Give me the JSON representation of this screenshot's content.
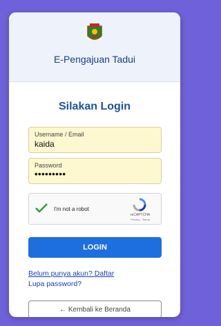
{
  "header": {
    "app_title": "E-Pengajuan Tadui",
    "logo_icon": "regency-crest-icon"
  },
  "login": {
    "title": "Silakan Login",
    "username": {
      "label": "Username / Email",
      "value": "kaida"
    },
    "password": {
      "label": "Password",
      "value": "•••••••••"
    },
    "captcha": {
      "label": "I'm not a robot",
      "brand": "reCAPTCHA",
      "links": "Privacy - Terms"
    },
    "submit_label": "LOGIN",
    "register_link": "Belum punya akun? Daftar",
    "forgot_link": "Lupa password?",
    "back_label": "← Kembali ke Beranda"
  },
  "colors": {
    "background": "#6f61d9",
    "primary": "#1d6fe0",
    "input_bg": "#fdf8cf"
  }
}
